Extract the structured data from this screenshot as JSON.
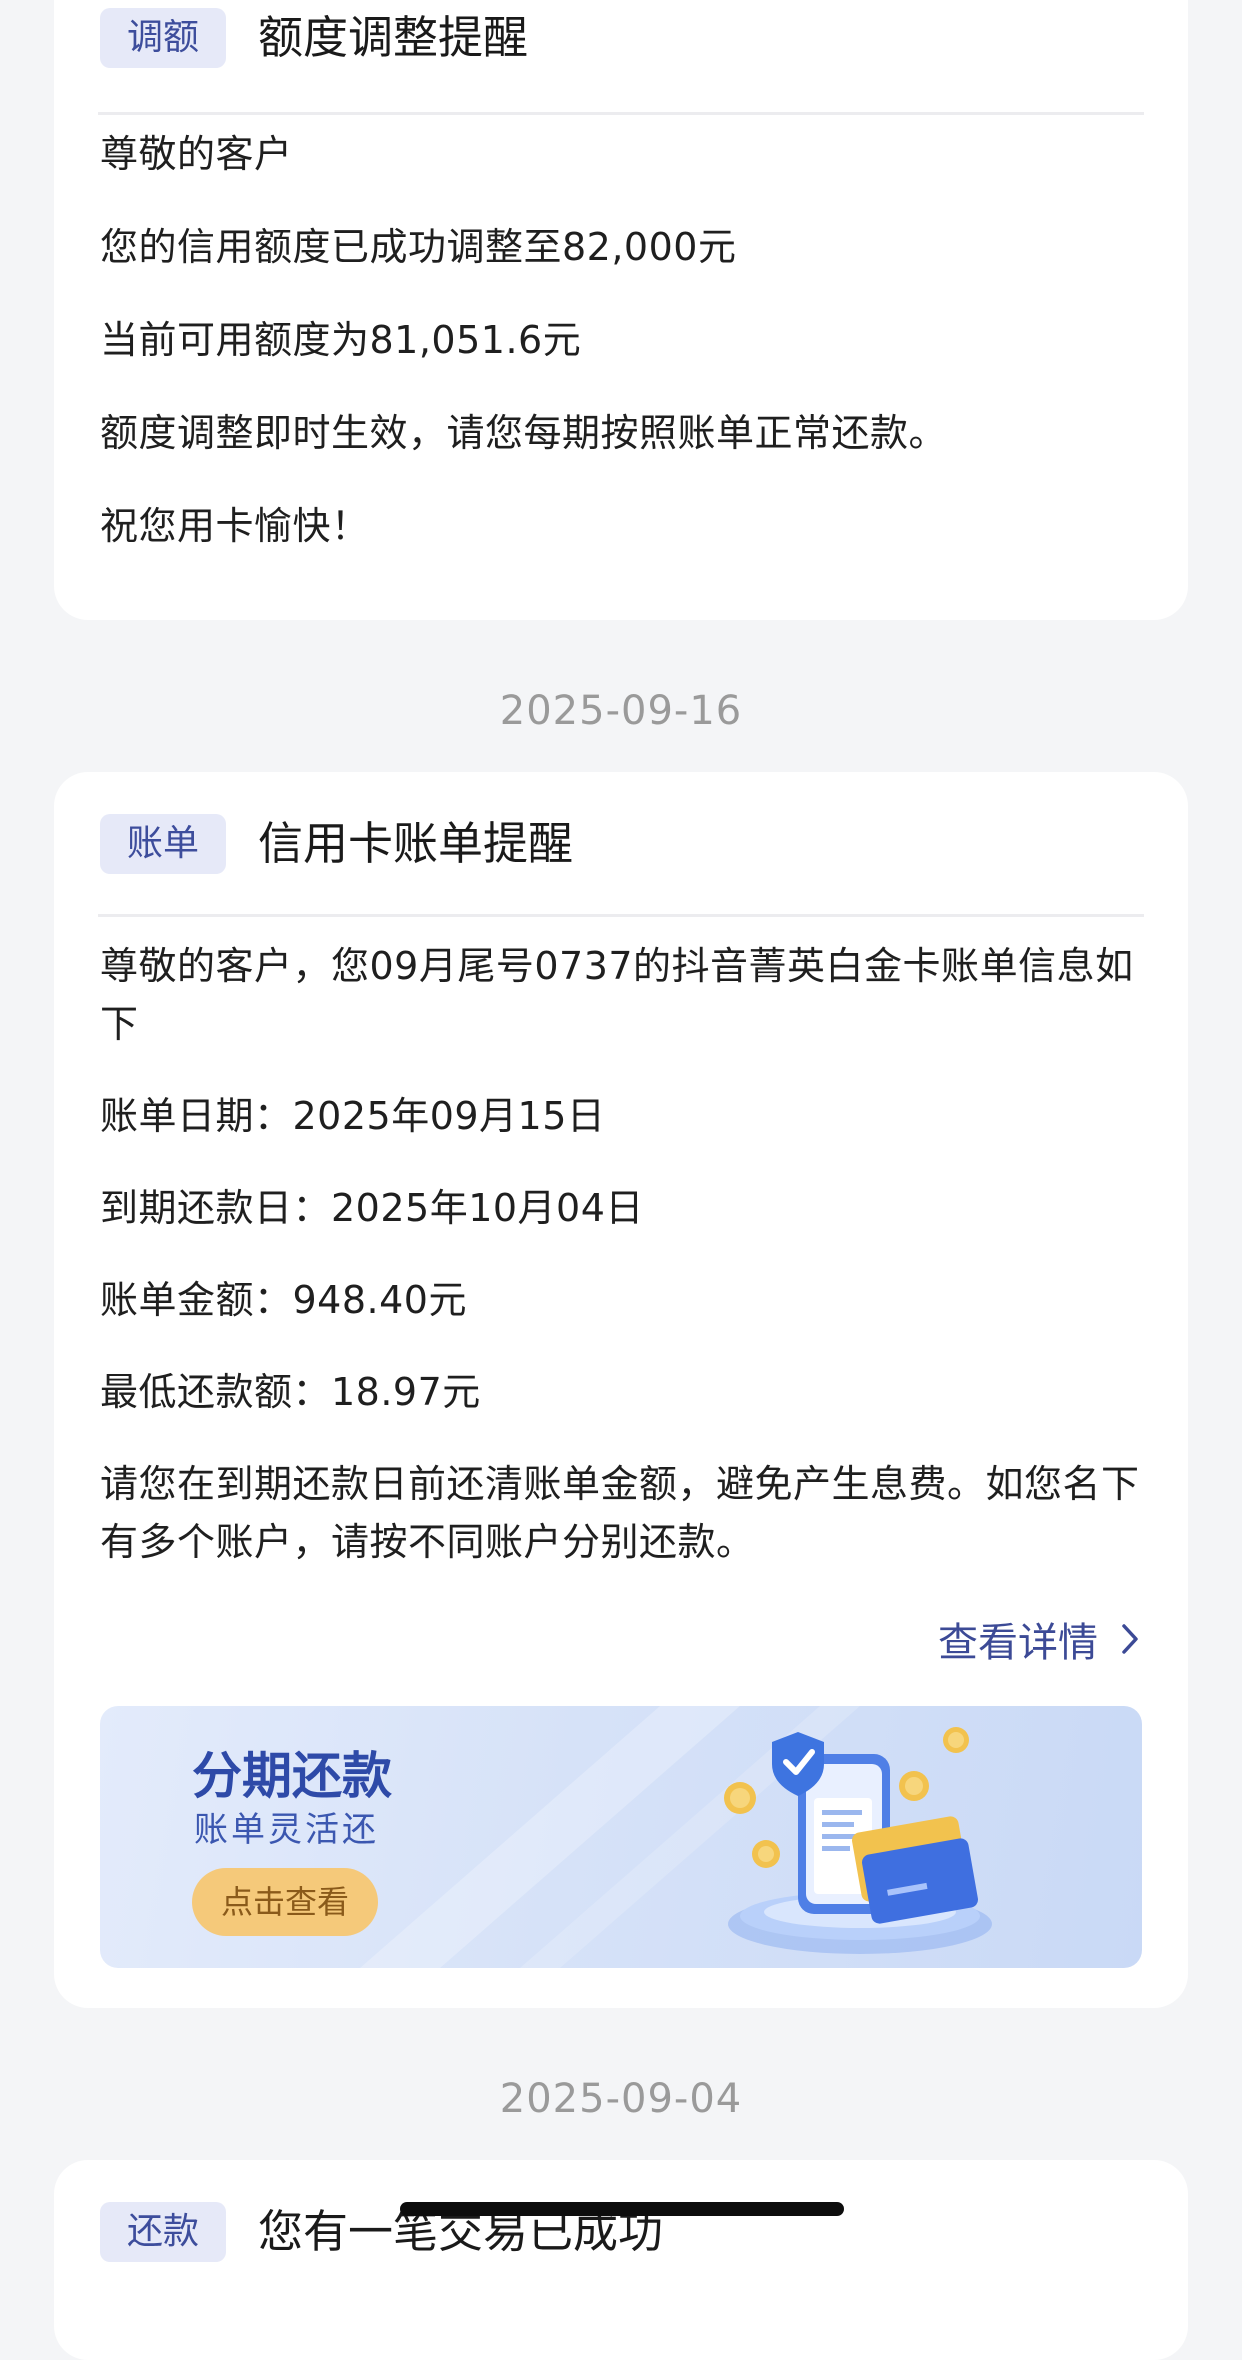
{
  "cards": [
    {
      "tag": "调额",
      "title": "额度调整提醒",
      "lines": [
        "尊敬的客户",
        "您的信用额度已成功调整至82,000元",
        "当前可用额度为81,051.6元",
        "额度调整即时生效，请您每期按照账单正常还款。",
        "祝您用卡愉快！"
      ]
    },
    {
      "date": "2025-09-16",
      "tag": "账单",
      "title": "信用卡账单提醒",
      "lines": [
        "尊敬的客户，您09月尾号0737的抖音菁英白金卡账单信息如下",
        "账单日期：2025年09月15日",
        "到期还款日：2025年10月04日",
        "账单金额：948.40元",
        "最低还款额：18.97元",
        "请您在到期还款日前还清账单金额，避免产生息费。如您名下有多个账户，请按不同账户分别还款。"
      ],
      "detail_link": "查看详情",
      "banner": {
        "title": "分期还款",
        "subtitle": "账单灵活还",
        "button": "点击查看"
      }
    },
    {
      "date": "2025-09-04",
      "tag": "还款",
      "title": "您有一笔交易已成功"
    }
  ],
  "colors": {
    "page_bg": "#f4f5f7",
    "tag_bg": "#e6e9f8",
    "tag_text": "#3d4d9c",
    "link": "#3c4a96",
    "date_text": "#9a9a9a",
    "banner_button": "#f5c97a"
  }
}
